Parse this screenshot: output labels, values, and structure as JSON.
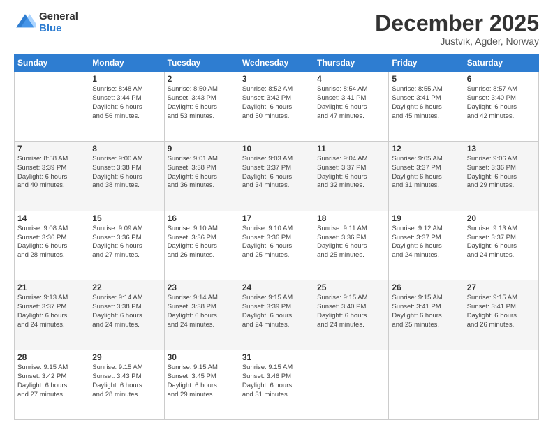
{
  "logo": {
    "general": "General",
    "blue": "Blue"
  },
  "header": {
    "month": "December 2025",
    "location": "Justvik, Agder, Norway"
  },
  "days_of_week": [
    "Sunday",
    "Monday",
    "Tuesday",
    "Wednesday",
    "Thursday",
    "Friday",
    "Saturday"
  ],
  "weeks": [
    [
      {
        "day": "",
        "info": ""
      },
      {
        "day": "1",
        "info": "Sunrise: 8:48 AM\nSunset: 3:44 PM\nDaylight: 6 hours\nand 56 minutes."
      },
      {
        "day": "2",
        "info": "Sunrise: 8:50 AM\nSunset: 3:43 PM\nDaylight: 6 hours\nand 53 minutes."
      },
      {
        "day": "3",
        "info": "Sunrise: 8:52 AM\nSunset: 3:42 PM\nDaylight: 6 hours\nand 50 minutes."
      },
      {
        "day": "4",
        "info": "Sunrise: 8:54 AM\nSunset: 3:41 PM\nDaylight: 6 hours\nand 47 minutes."
      },
      {
        "day": "5",
        "info": "Sunrise: 8:55 AM\nSunset: 3:41 PM\nDaylight: 6 hours\nand 45 minutes."
      },
      {
        "day": "6",
        "info": "Sunrise: 8:57 AM\nSunset: 3:40 PM\nDaylight: 6 hours\nand 42 minutes."
      }
    ],
    [
      {
        "day": "7",
        "info": "Sunrise: 8:58 AM\nSunset: 3:39 PM\nDaylight: 6 hours\nand 40 minutes."
      },
      {
        "day": "8",
        "info": "Sunrise: 9:00 AM\nSunset: 3:38 PM\nDaylight: 6 hours\nand 38 minutes."
      },
      {
        "day": "9",
        "info": "Sunrise: 9:01 AM\nSunset: 3:38 PM\nDaylight: 6 hours\nand 36 minutes."
      },
      {
        "day": "10",
        "info": "Sunrise: 9:03 AM\nSunset: 3:37 PM\nDaylight: 6 hours\nand 34 minutes."
      },
      {
        "day": "11",
        "info": "Sunrise: 9:04 AM\nSunset: 3:37 PM\nDaylight: 6 hours\nand 32 minutes."
      },
      {
        "day": "12",
        "info": "Sunrise: 9:05 AM\nSunset: 3:37 PM\nDaylight: 6 hours\nand 31 minutes."
      },
      {
        "day": "13",
        "info": "Sunrise: 9:06 AM\nSunset: 3:36 PM\nDaylight: 6 hours\nand 29 minutes."
      }
    ],
    [
      {
        "day": "14",
        "info": "Sunrise: 9:08 AM\nSunset: 3:36 PM\nDaylight: 6 hours\nand 28 minutes."
      },
      {
        "day": "15",
        "info": "Sunrise: 9:09 AM\nSunset: 3:36 PM\nDaylight: 6 hours\nand 27 minutes."
      },
      {
        "day": "16",
        "info": "Sunrise: 9:10 AM\nSunset: 3:36 PM\nDaylight: 6 hours\nand 26 minutes."
      },
      {
        "day": "17",
        "info": "Sunrise: 9:10 AM\nSunset: 3:36 PM\nDaylight: 6 hours\nand 25 minutes."
      },
      {
        "day": "18",
        "info": "Sunrise: 9:11 AM\nSunset: 3:36 PM\nDaylight: 6 hours\nand 25 minutes."
      },
      {
        "day": "19",
        "info": "Sunrise: 9:12 AM\nSunset: 3:37 PM\nDaylight: 6 hours\nand 24 minutes."
      },
      {
        "day": "20",
        "info": "Sunrise: 9:13 AM\nSunset: 3:37 PM\nDaylight: 6 hours\nand 24 minutes."
      }
    ],
    [
      {
        "day": "21",
        "info": "Sunrise: 9:13 AM\nSunset: 3:37 PM\nDaylight: 6 hours\nand 24 minutes."
      },
      {
        "day": "22",
        "info": "Sunrise: 9:14 AM\nSunset: 3:38 PM\nDaylight: 6 hours\nand 24 minutes."
      },
      {
        "day": "23",
        "info": "Sunrise: 9:14 AM\nSunset: 3:38 PM\nDaylight: 6 hours\nand 24 minutes."
      },
      {
        "day": "24",
        "info": "Sunrise: 9:15 AM\nSunset: 3:39 PM\nDaylight: 6 hours\nand 24 minutes."
      },
      {
        "day": "25",
        "info": "Sunrise: 9:15 AM\nSunset: 3:40 PM\nDaylight: 6 hours\nand 24 minutes."
      },
      {
        "day": "26",
        "info": "Sunrise: 9:15 AM\nSunset: 3:41 PM\nDaylight: 6 hours\nand 25 minutes."
      },
      {
        "day": "27",
        "info": "Sunrise: 9:15 AM\nSunset: 3:41 PM\nDaylight: 6 hours\nand 26 minutes."
      }
    ],
    [
      {
        "day": "28",
        "info": "Sunrise: 9:15 AM\nSunset: 3:42 PM\nDaylight: 6 hours\nand 27 minutes."
      },
      {
        "day": "29",
        "info": "Sunrise: 9:15 AM\nSunset: 3:43 PM\nDaylight: 6 hours\nand 28 minutes."
      },
      {
        "day": "30",
        "info": "Sunrise: 9:15 AM\nSunset: 3:45 PM\nDaylight: 6 hours\nand 29 minutes."
      },
      {
        "day": "31",
        "info": "Sunrise: 9:15 AM\nSunset: 3:46 PM\nDaylight: 6 hours\nand 31 minutes."
      },
      {
        "day": "",
        "info": ""
      },
      {
        "day": "",
        "info": ""
      },
      {
        "day": "",
        "info": ""
      }
    ]
  ]
}
